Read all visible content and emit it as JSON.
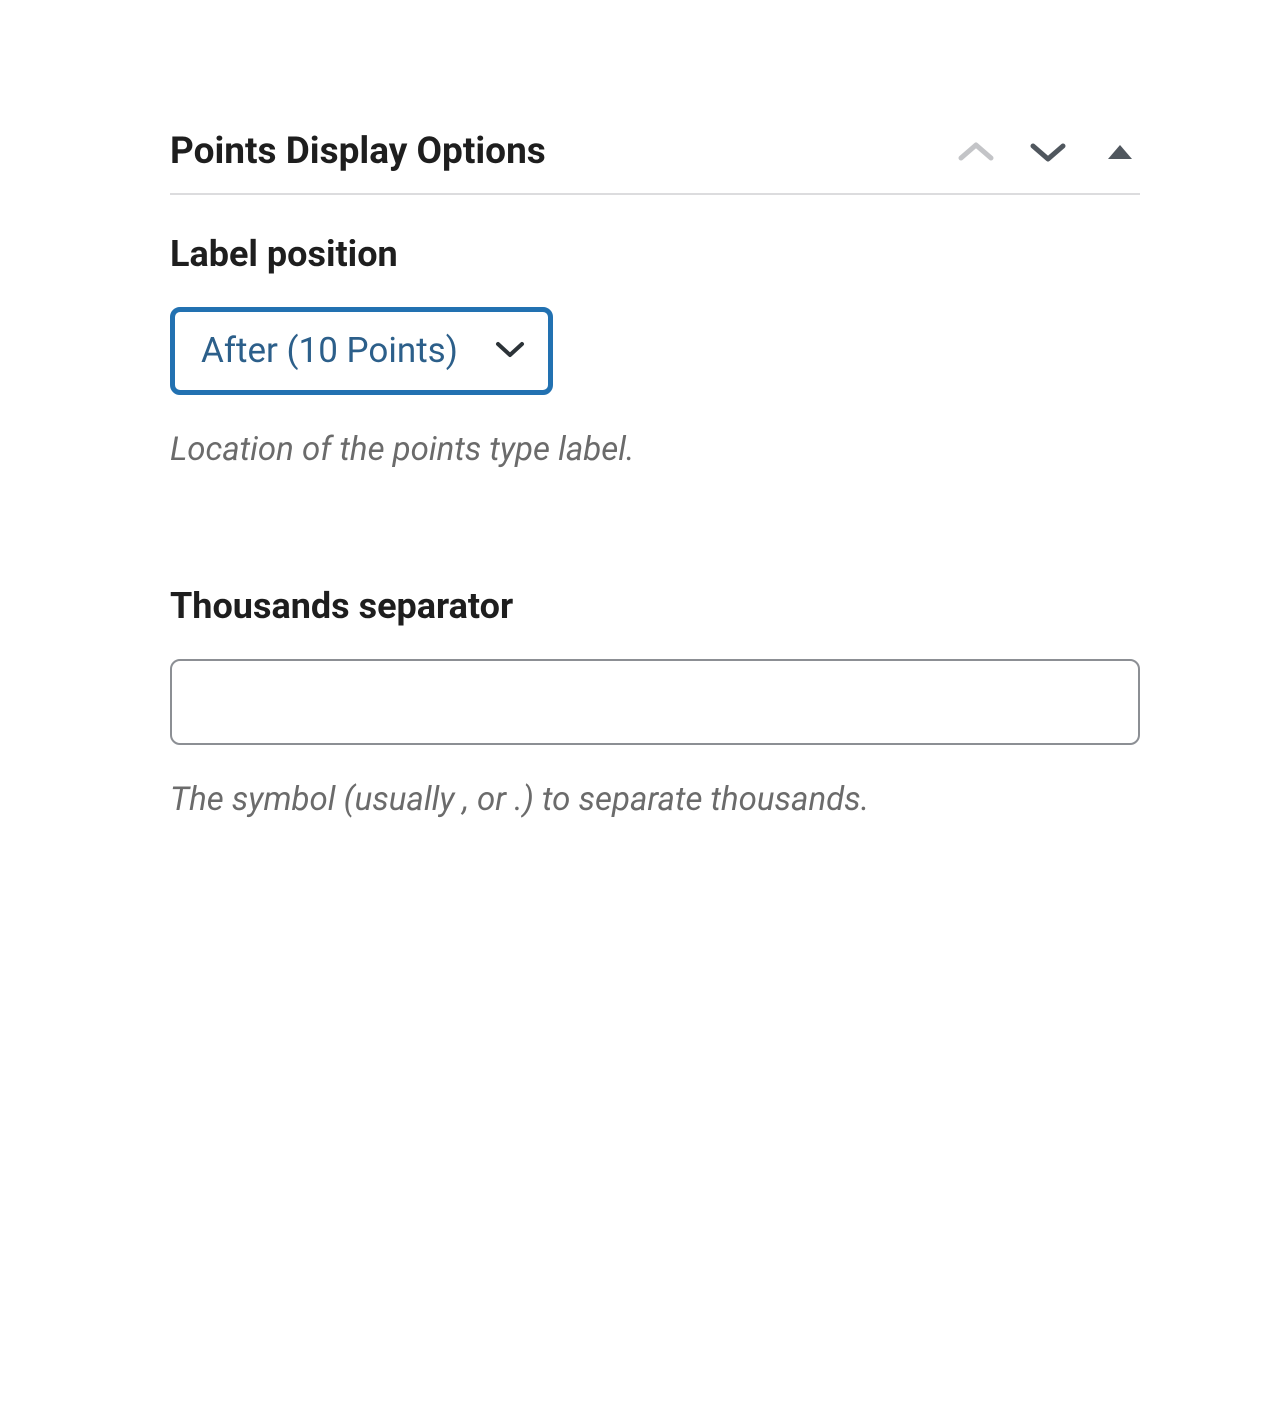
{
  "panel": {
    "title": "Points Display Options"
  },
  "labelPosition": {
    "label": "Label position",
    "selected": "After (10 Points)",
    "help": "Location of the points type label."
  },
  "thousandsSeparator": {
    "label": "Thousands separator",
    "value": "",
    "help": "The symbol (usually , or .) to separate thousands."
  }
}
